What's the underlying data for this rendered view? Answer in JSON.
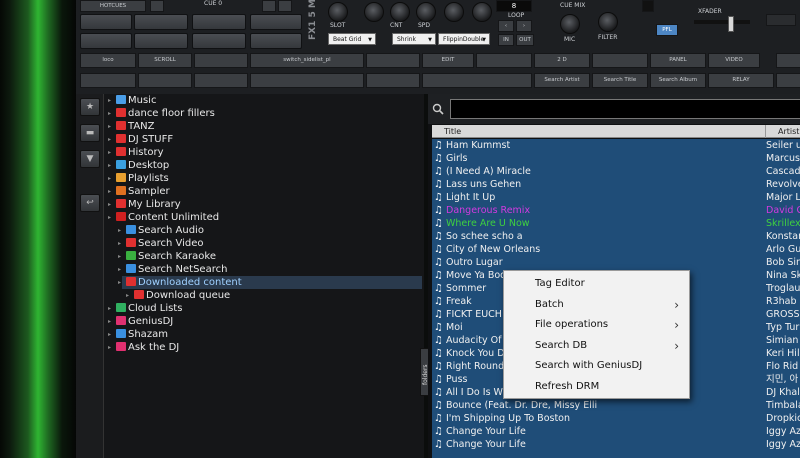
{
  "top": {
    "hotcues_label": "HOTCUES",
    "cue_label": "CUE 0",
    "logo": "FX1 5 M",
    "knob_labels": [
      "SLOT",
      "CNT",
      "SPD"
    ],
    "effect_dropdowns": [
      "Beat Grid",
      "Shrink",
      "FlippinDouble"
    ],
    "loop_value": "8",
    "loop_label": "LOOP",
    "in_label": "IN",
    "out_label": "OUT",
    "cue_mix_label": "CUE MIX",
    "mic_label": "MIC",
    "filter_label": "FILTER",
    "pfl_label": "PFL",
    "xfader_label": "XFADER",
    "row1_buttons": [
      "loco",
      "SCROLL",
      "",
      "switch_sidelist_pl",
      "",
      "EDIT",
      "",
      "2 D",
      "",
      "PANEL",
      "VIDEO",
      ""
    ],
    "row2_buttons": [
      "",
      "",
      "",
      "",
      "",
      "",
      "Search Artist",
      "Search Title",
      "Search Album",
      "RELAY",
      ""
    ]
  },
  "sidebar": {
    "buttons": [
      {
        "icon": "star-icon",
        "glyph": "★"
      },
      {
        "icon": "monitor-icon",
        "glyph": "▬"
      },
      {
        "icon": "filter-icon",
        "glyph": "▼"
      },
      {
        "icon": "back-icon",
        "glyph": "↩"
      }
    ]
  },
  "tree": {
    "folders_tab": "folders",
    "nodes": [
      {
        "label": "Music",
        "color": "#4a9ee8",
        "level": 0
      },
      {
        "label": "dance floor fillers",
        "color": "#e03030",
        "level": 0
      },
      {
        "label": "TANZ",
        "color": "#e03030",
        "level": 0
      },
      {
        "label": "DJ STUFF",
        "color": "#e03030",
        "level": 0
      },
      {
        "label": "History",
        "color": "#e03030",
        "level": 0
      },
      {
        "label": "Desktop",
        "color": "#3aa0e0",
        "level": 0
      },
      {
        "label": "Playlists",
        "color": "#e8a030",
        "level": 0
      },
      {
        "label": "Sampler",
        "color": "#e07020",
        "level": 0
      },
      {
        "label": "My Library",
        "color": "#e03030",
        "level": 0
      },
      {
        "label": "Content Unlimited",
        "color": "#d02020",
        "level": 0
      },
      {
        "label": "Search Audio",
        "color": "#3a90e0",
        "level": 1
      },
      {
        "label": "Search Video",
        "color": "#e03030",
        "level": 1
      },
      {
        "label": "Search Karaoke",
        "color": "#3ab040",
        "level": 1
      },
      {
        "label": "Search NetSearch",
        "color": "#3a90e0",
        "level": 1
      },
      {
        "label": "Downloaded content",
        "color": "#e03030",
        "level": 1,
        "selected": true
      },
      {
        "label": "Download queue",
        "color": "#e03030",
        "level": 2
      },
      {
        "label": "Cloud Lists",
        "color": "#30b060",
        "level": 0
      },
      {
        "label": "GeniusDJ",
        "color": "#e03070",
        "level": 0
      },
      {
        "label": "Shazam",
        "color": "#3a90e0",
        "level": 0
      },
      {
        "label": "Ask the DJ",
        "color": "#e03070",
        "level": 0
      }
    ]
  },
  "browser": {
    "search_placeholder": "",
    "columns": [
      "Title",
      "Artist"
    ],
    "rows": [
      {
        "title": "Ham Kummst",
        "artist": "Seiler u"
      },
      {
        "title": "Girls",
        "artist": "Marcus"
      },
      {
        "title": "(I Need A) Miracle",
        "artist": "Cascada"
      },
      {
        "title": "Lass uns Gehen",
        "artist": "Revolve"
      },
      {
        "title": "Light It Up",
        "artist": "Major L"
      },
      {
        "title": "Dangerous Remix",
        "artist": "David G",
        "style": "magenta"
      },
      {
        "title": "Where Are U Now",
        "artist": "Skrillex",
        "style": "green"
      },
      {
        "title": "So schee scho a",
        "artist": "Konstan"
      },
      {
        "title": "City of New Orleans",
        "artist": "Arlo Gu"
      },
      {
        "title": "Outro Lugar",
        "artist": "Bob Sin"
      },
      {
        "title": "Move Ya Body (Nightcrawlers remix) HQ SOU...",
        "artist": "Nina Sk"
      },
      {
        "title": "Sommer",
        "artist": "Troglau"
      },
      {
        "title": "Freak",
        "artist": "R3hab"
      },
      {
        "title": "FICKT EUCH",
        "artist": "GROSS"
      },
      {
        "title": "Moi",
        "artist": "Typ Tur"
      },
      {
        "title": "Audacity Of Huge",
        "artist": "Simian"
      },
      {
        "title": "Knock You Down",
        "artist": "Keri Hil"
      },
      {
        "title": "Right Round",
        "artist": "Flo Rid"
      },
      {
        "title": "Puss",
        "artist": "지민, 아"
      },
      {
        "title": "All I Do Is Win",
        "artist": "DJ Khal"
      },
      {
        "title": "Bounce (Feat. Dr. Dre, Missy Elli",
        "artist": "Timbala"
      },
      {
        "title": "I'm Shipping Up To Boston",
        "artist": "Dropkic"
      },
      {
        "title": "Change Your Life",
        "artist": "Iggy Az"
      },
      {
        "title": "Change Your Life",
        "artist": "Iggy Az"
      }
    ]
  },
  "context_menu": {
    "items": [
      {
        "label": "Tag Editor",
        "submenu": false
      },
      {
        "label": "Batch",
        "submenu": true
      },
      {
        "label": "File operations",
        "submenu": true
      },
      {
        "label": "Search DB",
        "submenu": true
      },
      {
        "label": "Search with GeniusDJ",
        "submenu": false
      },
      {
        "label": "Refresh DRM",
        "submenu": false
      }
    ]
  }
}
